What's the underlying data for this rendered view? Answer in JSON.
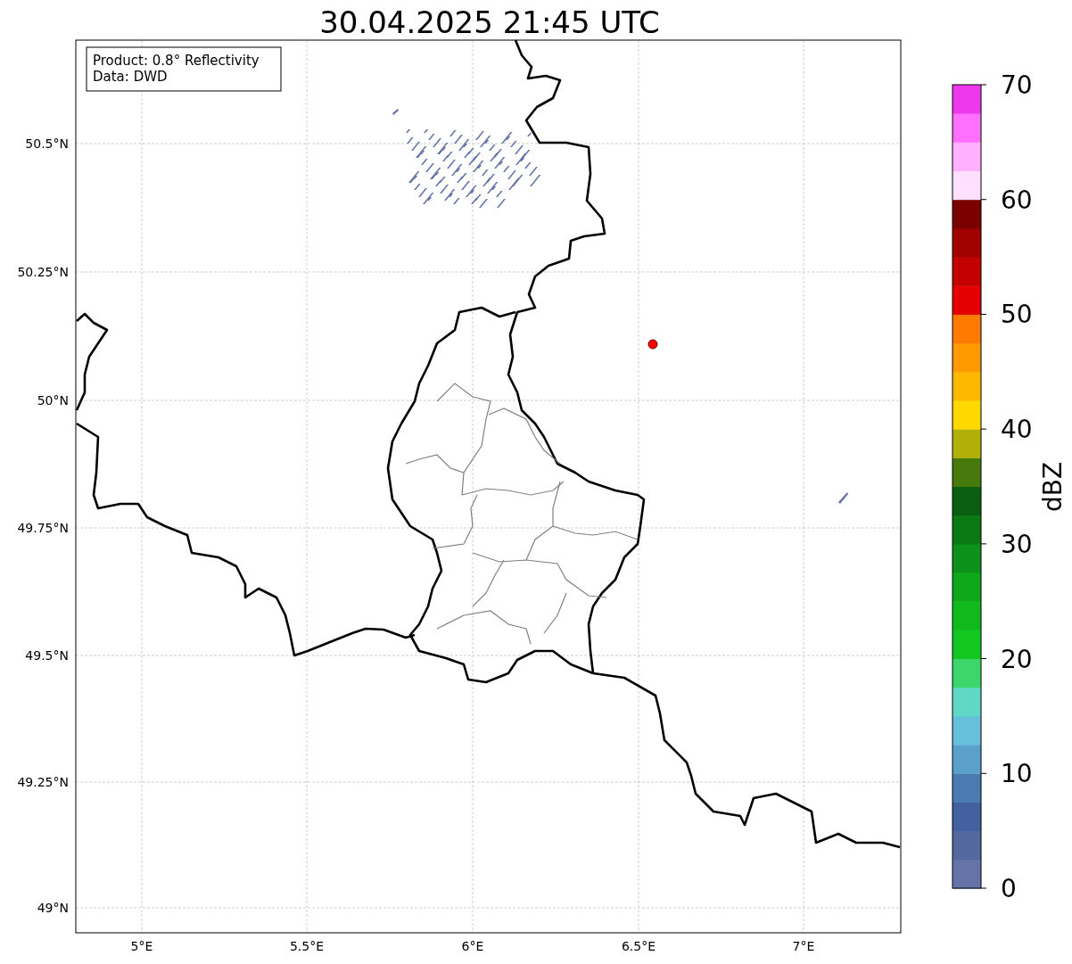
{
  "title": "30.04.2025 21:45 UTC",
  "map": {
    "info_lines": [
      "Product: 0.8° Reflectivity",
      "Data: DWD"
    ],
    "lat_labels": [
      "50.5°N",
      "50.25°N",
      "50°N",
      "49.75°N",
      "49.5°N",
      "49.25°N",
      "49°N"
    ],
    "lon_labels": [
      "5°E",
      "5.5°E",
      "6°E",
      "6.5°E",
      "7°E"
    ]
  },
  "colorbar": {
    "label": "dBZ",
    "tick_labels": [
      "70",
      "60",
      "50",
      "40",
      "30",
      "20",
      "10",
      "0"
    ],
    "bins": [
      {
        "color": "#6474a8"
      },
      {
        "color": "#5468a0"
      },
      {
        "color": "#4360a0"
      },
      {
        "color": "#4a7ab0"
      },
      {
        "color": "#5aa0c8"
      },
      {
        "color": "#66c0dc"
      },
      {
        "color": "#60d8c8"
      },
      {
        "color": "#3cd66c"
      },
      {
        "color": "#12c820"
      },
      {
        "color": "#10ba1c"
      },
      {
        "color": "#0ea81a"
      },
      {
        "color": "#0c921a"
      },
      {
        "color": "#0b7a14"
      },
      {
        "color": "#095e10"
      },
      {
        "color": "#467a0c"
      },
      {
        "color": "#b0b008"
      },
      {
        "color": "#ffd800"
      },
      {
        "color": "#ffb800"
      },
      {
        "color": "#ff9a00"
      },
      {
        "color": "#ff7a00"
      },
      {
        "color": "#e40000"
      },
      {
        "color": "#c40000"
      },
      {
        "color": "#a00000"
      },
      {
        "color": "#7a0000"
      },
      {
        "color": "#ffe0ff"
      },
      {
        "color": "#ffb0ff"
      },
      {
        "color": "#ff70ff"
      },
      {
        "color": "#ee38ee"
      }
    ]
  }
}
